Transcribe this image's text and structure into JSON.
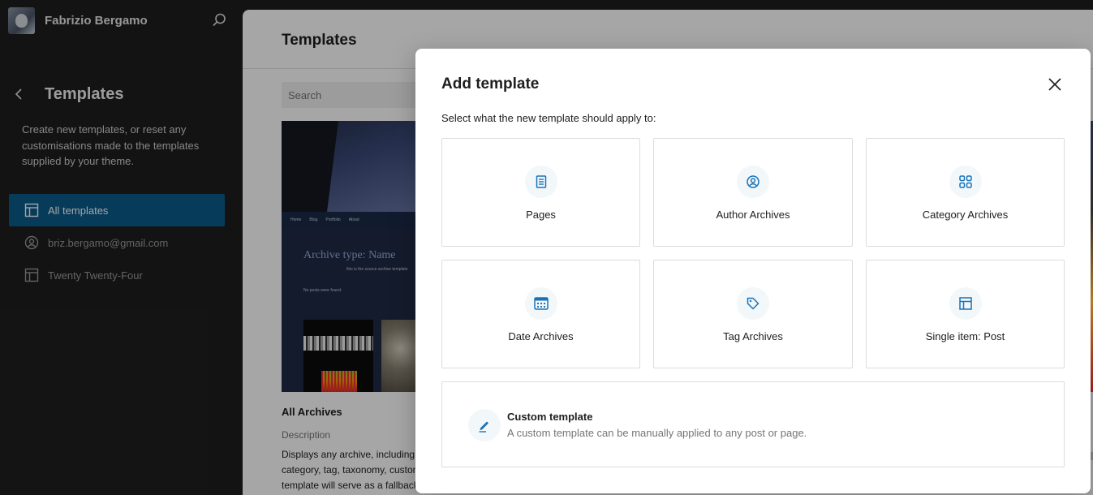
{
  "sidebar": {
    "site_name": "Fabrizio Bergamo",
    "title": "Templates",
    "description": "Create new templates, or reset any customisations made to the templates supplied by your theme.",
    "nav": [
      {
        "label": "All templates",
        "icon": "layout-icon",
        "active": true
      },
      {
        "label": "briz.bergamo@gmail.com",
        "icon": "user-circle-icon",
        "active": false
      },
      {
        "label": "Twenty Twenty-Four",
        "icon": "layout-icon",
        "active": false
      }
    ]
  },
  "main": {
    "title": "Templates",
    "search_placeholder": "Search",
    "preview": {
      "nav_links": [
        "Home",
        "Blog",
        "Portfolio",
        "About"
      ],
      "archive_title": "Archive type: Name",
      "subtitle": "this is the source archive template",
      "no_posts": "No posts were found."
    },
    "card_name": "All Archives",
    "description_label": "Description",
    "description_lines": [
      "Displays any archive, including",
      "category, tag, taxonomy, custom",
      "template will serve as a fallback"
    ]
  },
  "modal": {
    "title": "Add template",
    "subtitle": "Select what the new template should apply to:",
    "options": [
      {
        "label": "Pages",
        "icon": "page-icon"
      },
      {
        "label": "Author Archives",
        "icon": "user-circle-icon"
      },
      {
        "label": "Category Archives",
        "icon": "category-icon"
      },
      {
        "label": "Date Archives",
        "icon": "calendar-icon"
      },
      {
        "label": "Tag Archives",
        "icon": "tag-icon"
      },
      {
        "label": "Single item: Post",
        "icon": "layout-icon"
      }
    ],
    "custom": {
      "title": "Custom template",
      "description": "A custom template can be manually applied to any post or page.",
      "icon": "pencil-icon"
    }
  },
  "colors": {
    "accent": "#0a5b8a",
    "icon_blue": "#1a73b8",
    "sidebar_bg": "#1e1e1e"
  }
}
